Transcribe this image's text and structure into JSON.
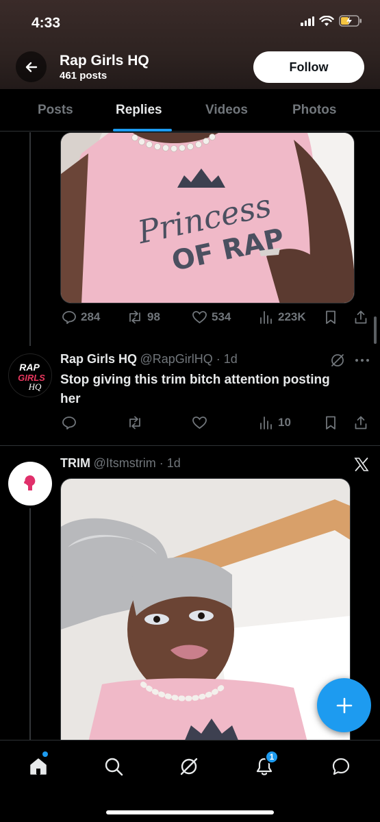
{
  "status_bar": {
    "time": "4:33"
  },
  "header": {
    "title": "Rap Girls HQ",
    "posts_count": "461 posts",
    "follow_label": "Follow"
  },
  "tabs": [
    {
      "label": "Posts",
      "active": false
    },
    {
      "label": "Replies",
      "active": true
    },
    {
      "label": "Videos",
      "active": false
    },
    {
      "label": "Photos",
      "active": false
    }
  ],
  "post1": {
    "image_text": [
      "Princess",
      "OF RAP"
    ],
    "metrics": {
      "replies": "284",
      "reposts": "98",
      "likes": "534",
      "views": "223K"
    }
  },
  "post2": {
    "avatar_text": [
      "RAP",
      "GIRLS",
      "HQ"
    ],
    "author_name": "Rap Girls HQ",
    "author_meta": "@RapGirlHQ · 1d",
    "text": "Stop giving this trim bitch attention posting her",
    "metrics": {
      "views": "10"
    }
  },
  "post3": {
    "author_name": "TRIM",
    "author_meta": "@Itsmstrim · 1d"
  },
  "bottom_nav": {
    "notifications_badge": "1"
  },
  "colors": {
    "accent": "#1d9bf0",
    "background": "#000000",
    "muted": "#71767b",
    "shirt_pink": "#f0b9c8"
  }
}
